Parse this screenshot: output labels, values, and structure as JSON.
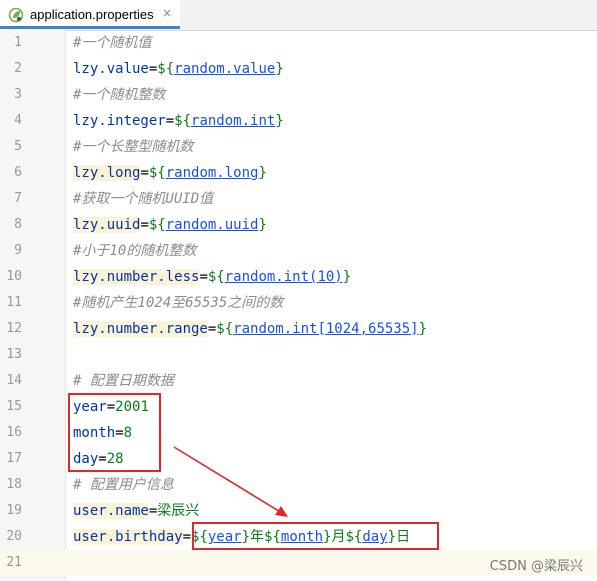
{
  "tab": {
    "filename": "application.properties",
    "close": "×",
    "icon": "spring-leaf-icon"
  },
  "lines": [
    {
      "num": "1",
      "parts": [
        {
          "t": "#一个随机值",
          "c": "cmt"
        }
      ]
    },
    {
      "num": "2",
      "parts": [
        {
          "t": "lzy.value",
          "c": "key"
        },
        {
          "t": "=",
          "c": ""
        },
        {
          "t": "${",
          "c": "val"
        },
        {
          "t": "random.value",
          "c": "ref"
        },
        {
          "t": "}",
          "c": "val"
        }
      ]
    },
    {
      "num": "3",
      "parts": [
        {
          "t": "#一个随机整数",
          "c": "cmt"
        }
      ]
    },
    {
      "num": "4",
      "parts": [
        {
          "t": "lzy.integer",
          "c": "key"
        },
        {
          "t": "=",
          "c": ""
        },
        {
          "t": "${",
          "c": "val"
        },
        {
          "t": "random.int",
          "c": "ref"
        },
        {
          "t": "}",
          "c": "val"
        }
      ]
    },
    {
      "num": "5",
      "parts": [
        {
          "t": "#一个长整型随机数",
          "c": "cmt"
        }
      ]
    },
    {
      "num": "6",
      "parts": [
        {
          "t": "lzy.long",
          "c": "key bg"
        },
        {
          "t": "=",
          "c": ""
        },
        {
          "t": "${",
          "c": "val"
        },
        {
          "t": "random.long",
          "c": "ref"
        },
        {
          "t": "}",
          "c": "val"
        }
      ]
    },
    {
      "num": "7",
      "parts": [
        {
          "t": "#获取一个随机UUID值",
          "c": "cmt"
        }
      ]
    },
    {
      "num": "8",
      "parts": [
        {
          "t": "lzy.uuid",
          "c": "key bg"
        },
        {
          "t": "=",
          "c": ""
        },
        {
          "t": "${",
          "c": "val"
        },
        {
          "t": "random.uuid",
          "c": "ref"
        },
        {
          "t": "}",
          "c": "val"
        }
      ]
    },
    {
      "num": "9",
      "parts": [
        {
          "t": "#小于10的随机整数",
          "c": "cmt"
        }
      ]
    },
    {
      "num": "10",
      "parts": [
        {
          "t": "lzy.number.less",
          "c": "key bg"
        },
        {
          "t": "=",
          "c": ""
        },
        {
          "t": "${",
          "c": "val"
        },
        {
          "t": "random.int(10)",
          "c": "ref"
        },
        {
          "t": "}",
          "c": "val"
        }
      ]
    },
    {
      "num": "11",
      "parts": [
        {
          "t": "#随机产生1024至65535之间的数",
          "c": "cmt"
        }
      ]
    },
    {
      "num": "12",
      "parts": [
        {
          "t": "lzy.number.range",
          "c": "key bg"
        },
        {
          "t": "=",
          "c": ""
        },
        {
          "t": "${",
          "c": "val"
        },
        {
          "t": "random.int[1024,65535]",
          "c": "ref"
        },
        {
          "t": "}",
          "c": "val"
        }
      ]
    },
    {
      "num": "13",
      "parts": []
    },
    {
      "num": "14",
      "parts": [
        {
          "t": "# 配置日期数据",
          "c": "cmt"
        }
      ]
    },
    {
      "num": "15",
      "parts": [
        {
          "t": "year",
          "c": "key"
        },
        {
          "t": "=",
          "c": ""
        },
        {
          "t": "2001",
          "c": "val"
        }
      ]
    },
    {
      "num": "16",
      "parts": [
        {
          "t": "month",
          "c": "key"
        },
        {
          "t": "=",
          "c": ""
        },
        {
          "t": "8",
          "c": "val"
        }
      ]
    },
    {
      "num": "17",
      "parts": [
        {
          "t": "day",
          "c": "key"
        },
        {
          "t": "=",
          "c": ""
        },
        {
          "t": "28",
          "c": "val"
        }
      ]
    },
    {
      "num": "18",
      "parts": [
        {
          "t": "# 配置用户信息",
          "c": "cmt"
        }
      ]
    },
    {
      "num": "19",
      "parts": [
        {
          "t": "user.name",
          "c": "key bg"
        },
        {
          "t": "=",
          "c": ""
        },
        {
          "t": "梁辰兴",
          "c": "val"
        }
      ]
    },
    {
      "num": "20",
      "parts": [
        {
          "t": "user.birthday",
          "c": "key bg"
        },
        {
          "t": "=",
          "c": ""
        },
        {
          "t": "${",
          "c": "val"
        },
        {
          "t": "year",
          "c": "ref"
        },
        {
          "t": "}年${",
          "c": "val"
        },
        {
          "t": "month",
          "c": "ref"
        },
        {
          "t": "}月${",
          "c": "val"
        },
        {
          "t": "day",
          "c": "ref"
        },
        {
          "t": "}日",
          "c": "val"
        }
      ]
    },
    {
      "num": "21",
      "parts": []
    }
  ],
  "current_line": "21",
  "annotation_color": "#e0282b",
  "watermark": "CSDN @梁辰兴"
}
